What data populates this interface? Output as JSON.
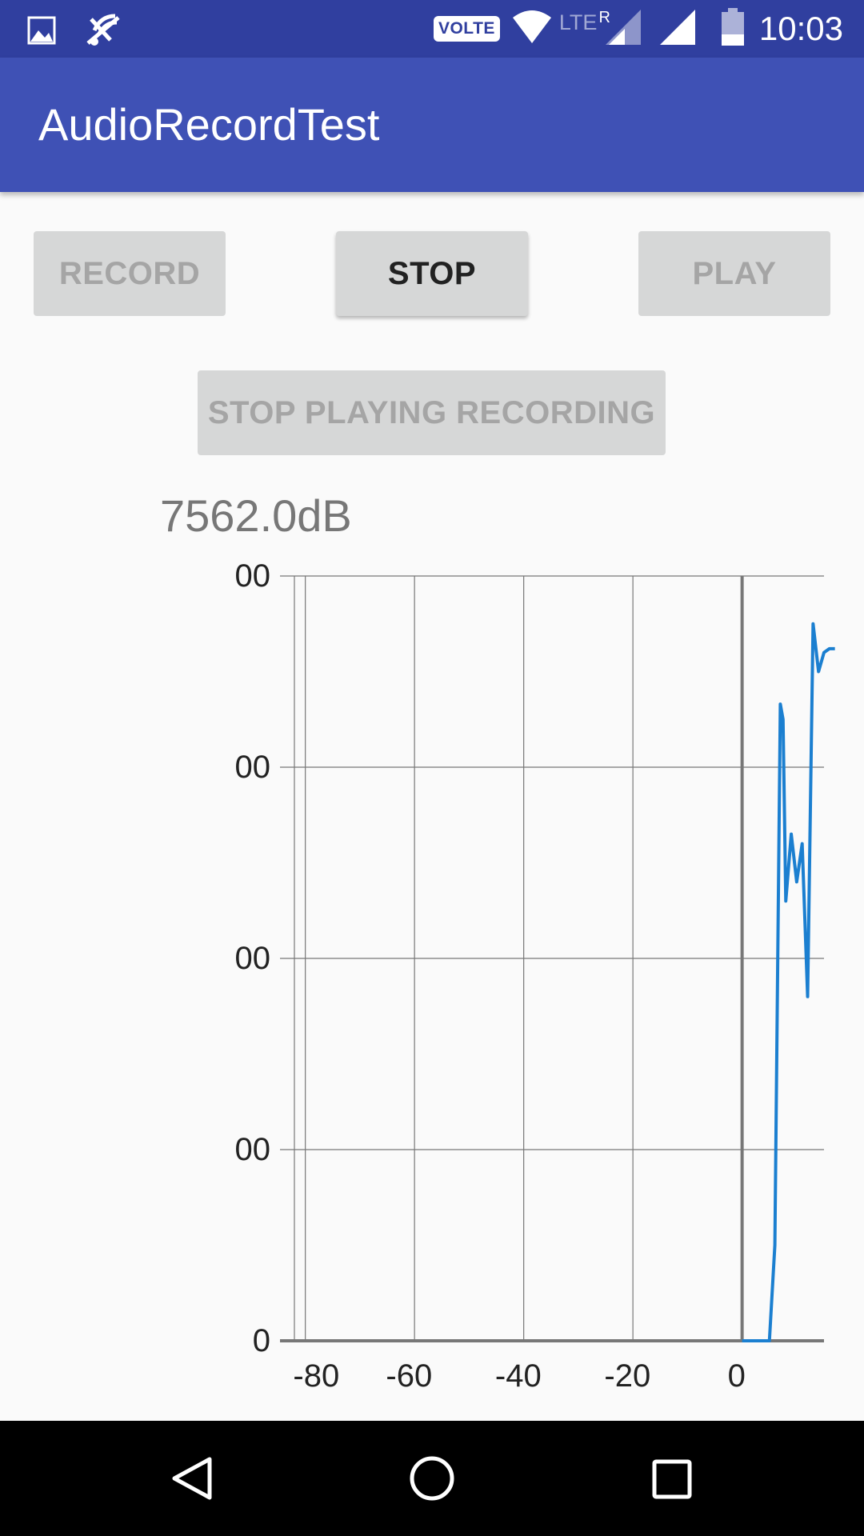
{
  "status_bar": {
    "time": "10:03",
    "volte_label": "VOLTE",
    "lte_label": "LTE",
    "roaming_label": "R",
    "icons": [
      "image-icon",
      "mute-icon",
      "wifi-icon",
      "signal-icon",
      "battery-icon"
    ]
  },
  "app_bar": {
    "title": "AudioRecordTest"
  },
  "buttons": {
    "record": "RECORD",
    "stop": "STOP",
    "play": "PLAY",
    "stop_playing": "STOP PLAYING RECORDING"
  },
  "level_readout": "7562.0dB",
  "chart_data": {
    "type": "line",
    "x_ticks": [
      -80,
      -60,
      -40,
      -20,
      0
    ],
    "y_tick_labels": [
      "00",
      "00",
      "00",
      "00",
      "0"
    ],
    "xlim": [
      -82,
      15
    ],
    "ylim": [
      0,
      4
    ],
    "series_color": "#1b7fd0",
    "x": [
      0,
      5,
      6,
      7,
      7.5,
      8,
      9,
      10,
      11,
      12,
      13,
      14,
      15,
      16,
      17
    ],
    "values": [
      0,
      0,
      0.5,
      3.33,
      3.25,
      2.3,
      2.65,
      2.4,
      2.6,
      1.8,
      3.75,
      3.5,
      3.6,
      3.62,
      3.62
    ]
  },
  "nav_bar": {
    "icons": [
      "back-icon",
      "home-icon",
      "recents-icon"
    ]
  }
}
